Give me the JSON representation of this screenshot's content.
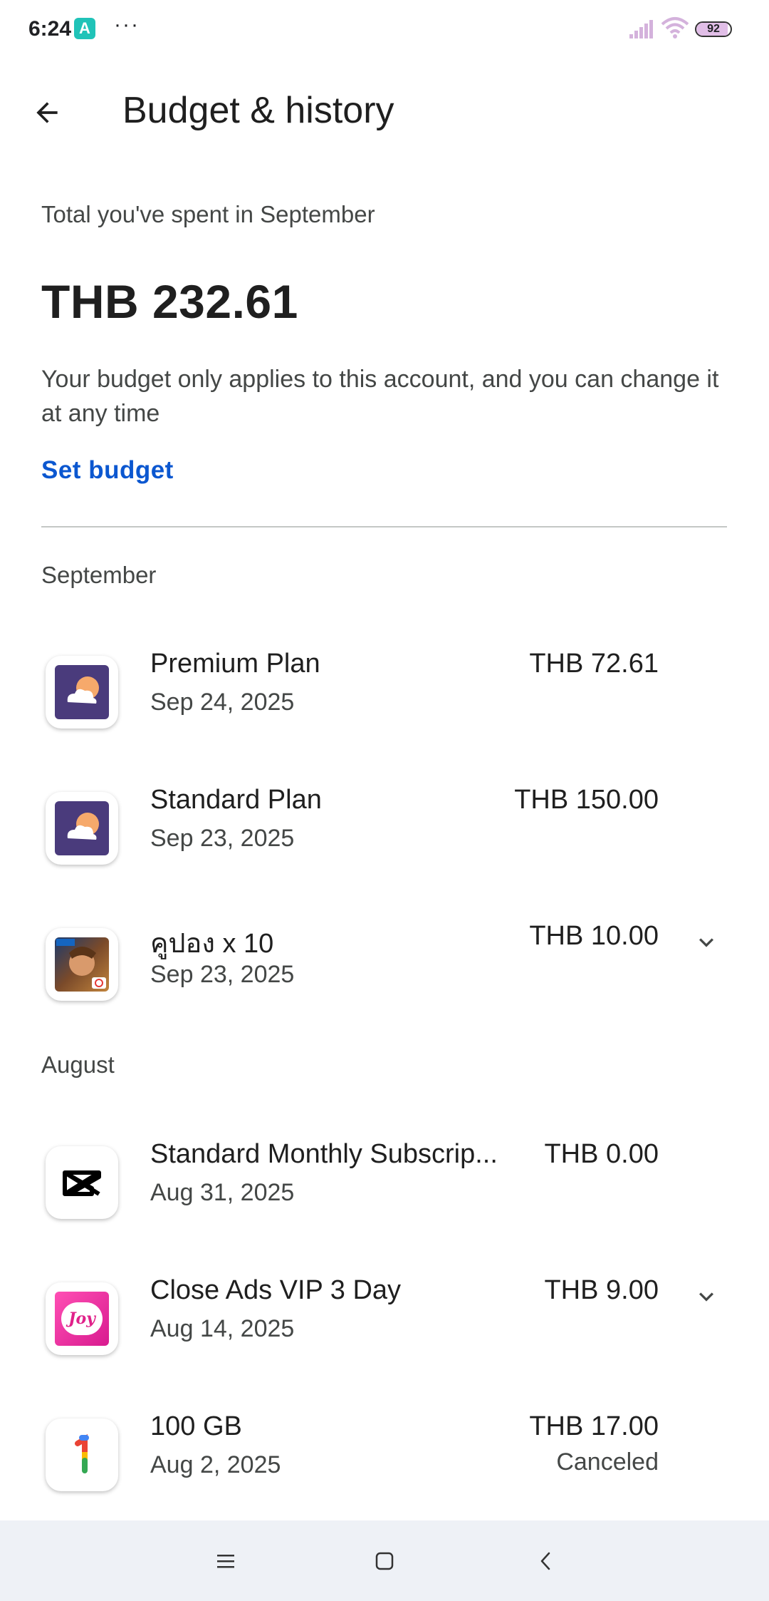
{
  "status_bar": {
    "time": "6:24",
    "app_badge": "A",
    "more": "···",
    "battery_level": "92",
    "battery_fraction": 0.92
  },
  "app_bar": {
    "title": "Budget & history",
    "back_icon": "arrow-back-icon"
  },
  "summary": {
    "label": "Total you've spent in September",
    "total": "THB 232.61",
    "note": "Your budget only applies to this account, and you can change it at any time",
    "set_budget": "Set budget"
  },
  "sections": [
    {
      "header": "September",
      "items": [
        {
          "title": "Premium Plan",
          "date": "Sep 24, 2025",
          "amount": "THB 72.61",
          "status": "",
          "icon": "cloud-sun-app-icon",
          "expandable": false
        },
        {
          "title": "Standard Plan",
          "date": "Sep 23, 2025",
          "amount": "THB 150.00",
          "status": "",
          "icon": "cloud-sun-app-icon",
          "expandable": false
        },
        {
          "title": "คูปอง x 10",
          "date": "Sep 23, 2025",
          "amount": "THB 10.00",
          "status": "",
          "icon": "game-hero-app-icon",
          "expandable": true
        }
      ]
    },
    {
      "header": "August",
      "items": [
        {
          "title": "Standard Monthly Subscrip...",
          "date": "Aug 31, 2025",
          "amount": "THB 0.00",
          "status": "",
          "icon": "capcut-app-icon",
          "expandable": false
        },
        {
          "title": "Close Ads VIP 3 Day",
          "date": "Aug 14, 2025",
          "amount": "THB 9.00",
          "status": "",
          "icon": "joy-app-icon",
          "expandable": true,
          "icon_text": "Joy"
        },
        {
          "title": "100 GB",
          "date": "Aug 2, 2025",
          "amount": "THB 17.00",
          "status": "Canceled",
          "icon": "google-one-app-icon",
          "expandable": false
        }
      ]
    }
  ],
  "nav_bar": {
    "menu_icon": "menu-icon",
    "home_icon": "home-square-icon",
    "back_icon": "back-triangle-icon"
  },
  "colors": {
    "link": "#0b57d0",
    "primary_text": "#1f1f1f",
    "secondary_text": "#444746",
    "divider": "#c4c7c5",
    "nav_bg": "#eef1f6"
  }
}
